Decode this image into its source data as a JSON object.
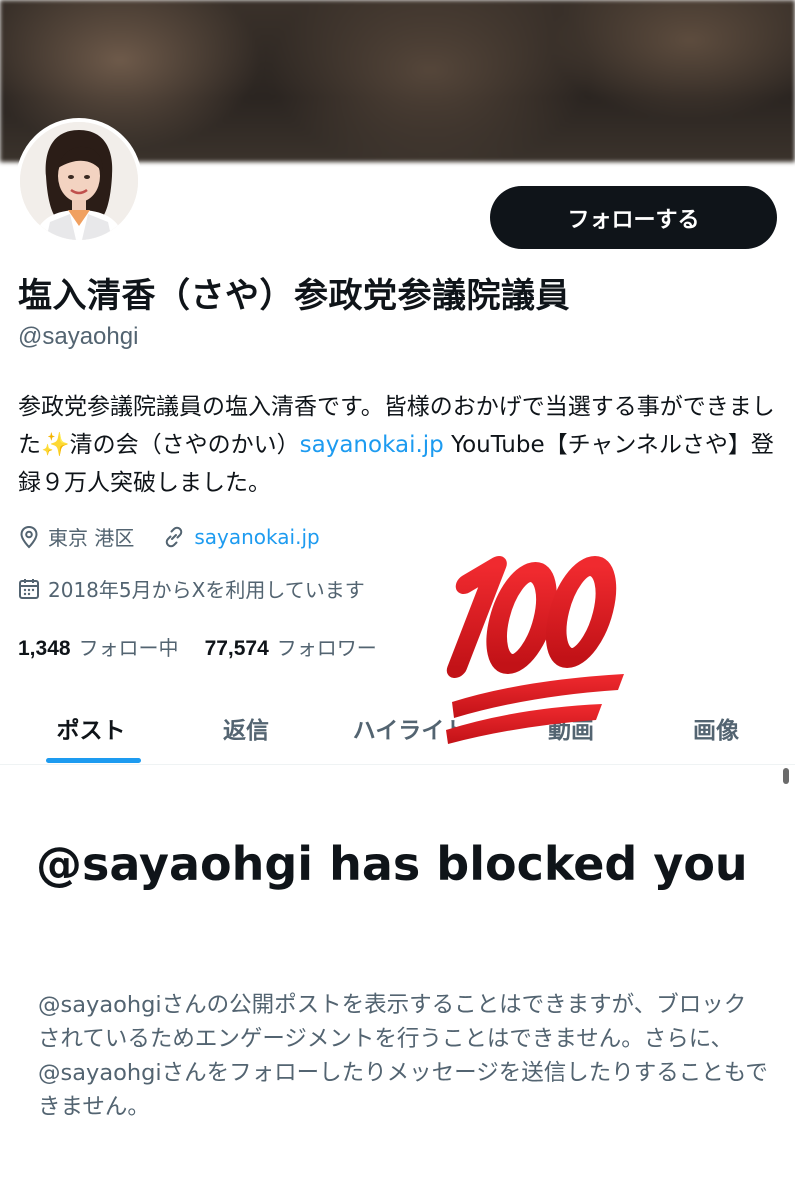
{
  "profile": {
    "display_name": "塩入清香（さや）参政党参議院議員",
    "handle": "@sayaohgi",
    "follow_label": "フォローする",
    "bio_part1": "参政党参議院議員の塩入清香です。皆様のおかげで当選する事ができました",
    "bio_sparkle": "✨",
    "bio_part2": "清の会（さやのかい）",
    "bio_link": "sayanokai.jp",
    "bio_part3": " YouTube【チャンネルさや】登録９万人突破しました。",
    "location": "東京 港区",
    "website": "sayanokai.jp",
    "joined": "2018年5月からXを利用しています",
    "following_count": "1,348",
    "following_label": "フォロー中",
    "followers_count": "77,574",
    "followers_label": "フォロワー"
  },
  "tabs": [
    {
      "label": "ポスト",
      "active": true
    },
    {
      "label": "返信",
      "active": false
    },
    {
      "label": "ハイライト",
      "active": false
    },
    {
      "label": "動画",
      "active": false
    },
    {
      "label": "画像",
      "active": false
    }
  ],
  "blocked": {
    "title": "@sayaohgi has blocked you",
    "description": "@sayaohgiさんの公開ポストを表示することはできますが、ブロックされているためエンゲージメントを行うことはできません。さらに、@sayaohgiさんをフォローしたりメッセージを送信したりすることもできません。"
  },
  "sticker": {
    "icon": "hundred-points-emoji-icon",
    "text": "100"
  },
  "colors": {
    "accent": "#1d9bf0",
    "text_primary": "#0f1419",
    "text_secondary": "#536471",
    "button_bg": "#0f1419",
    "sticker_red": "#d61a1f"
  }
}
